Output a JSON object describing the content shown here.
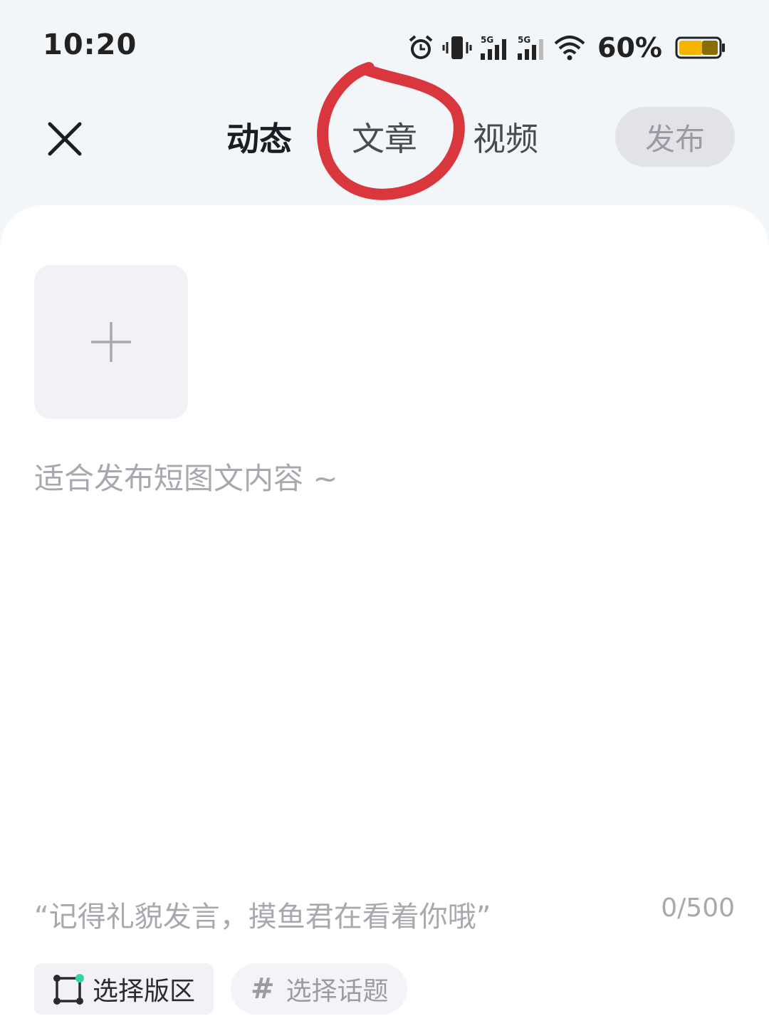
{
  "status_bar": {
    "time": "10:20",
    "battery_percent": "60%",
    "battery_level": 0.6,
    "icons": [
      "alarm-icon",
      "vibrate-icon",
      "signal-5g-icon",
      "signal-5g-icon",
      "wifi-icon",
      "battery-icon"
    ],
    "network_label_1": "5G",
    "network_label_2": "5G"
  },
  "header": {
    "close_icon": "close-icon",
    "tabs": [
      {
        "label": "动态",
        "active": true
      },
      {
        "label": "文章",
        "active": false
      },
      {
        "label": "视频",
        "active": false
      }
    ],
    "publish_label": "发布"
  },
  "editor": {
    "add_image_icon": "plus-icon",
    "placeholder": "适合发布短图文内容 ~",
    "value": "",
    "hint": "“记得礼貌发言，摸鱼君在看着你哦”",
    "counter": "0/500"
  },
  "bottom_bar": {
    "section_label": "选择版区",
    "topic_label": "选择话题",
    "topic_icon": "#"
  },
  "colors": {
    "accent_underline": "#b7a9f3",
    "annotation": "#d9363e",
    "battery_fill": "#f4b400",
    "section_dot": "#2fd59a"
  }
}
